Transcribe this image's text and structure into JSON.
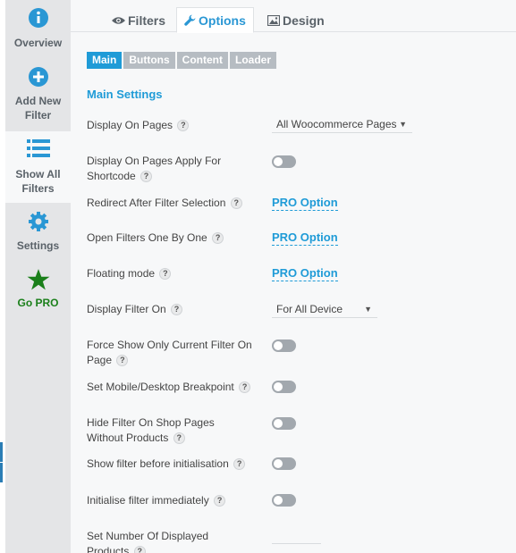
{
  "sidebar": {
    "items": [
      {
        "label_lines": [
          "Overview"
        ],
        "icon": "info-icon"
      },
      {
        "label_lines": [
          "Add New",
          "Filter"
        ],
        "icon": "plus-circle-icon"
      },
      {
        "label_lines": [
          "Show All",
          "Filters"
        ],
        "icon": "list-icon"
      },
      {
        "label_lines": [
          "Settings"
        ],
        "icon": "gear-icon"
      },
      {
        "label_lines": [
          "Go PRO"
        ],
        "icon": "star-icon"
      }
    ],
    "active_index": 2
  },
  "tabs": [
    {
      "label": "Filters",
      "icon": "eye-icon"
    },
    {
      "label": "Options",
      "icon": "wrench-icon"
    },
    {
      "label": "Design",
      "icon": "image-icon"
    }
  ],
  "active_tab": "Options",
  "subtabs": [
    "Main",
    "Buttons",
    "Content",
    "Loader"
  ],
  "active_subtab": "Main",
  "section_title": "Main Settings",
  "help_glyph": "?",
  "settings": {
    "display_on_pages": {
      "label_lines": [
        "Display On Pages"
      ],
      "value": "All Woocommerce Pages"
    },
    "apply_for_shortcode": {
      "label_lines": [
        "Display On Pages Apply For",
        "Shortcode"
      ],
      "state": "off"
    },
    "redirect_after": {
      "label_lines": [
        "Redirect After Filter Selection"
      ],
      "value": "PRO Option"
    },
    "open_one_by_one": {
      "label_lines": [
        "Open Filters One By One"
      ],
      "value": "PRO Option"
    },
    "floating_mode": {
      "label_lines": [
        "Floating mode"
      ],
      "value": "PRO Option"
    },
    "display_filter_on": {
      "label_lines": [
        "Display Filter On"
      ],
      "value": "For All Device"
    },
    "force_show_current": {
      "label_lines": [
        "Force Show Only Current Filter On",
        "Page"
      ],
      "state": "off"
    },
    "breakpoint": {
      "label_lines": [
        "Set Mobile/Desktop Breakpoint"
      ],
      "state": "off"
    },
    "hide_without_products": {
      "label_lines": [
        "Hide Filter On Shop Pages",
        "Without Products"
      ],
      "state": "off"
    },
    "show_before_init": {
      "label_lines": [
        "Show filter before initialisation"
      ],
      "state": "off"
    },
    "init_immediately": {
      "label_lines": [
        "Initialise filter immediately"
      ],
      "state": "off"
    },
    "displayed_products": {
      "label_lines": [
        "Set Number Of Displayed",
        "Products"
      ],
      "value": ""
    }
  }
}
